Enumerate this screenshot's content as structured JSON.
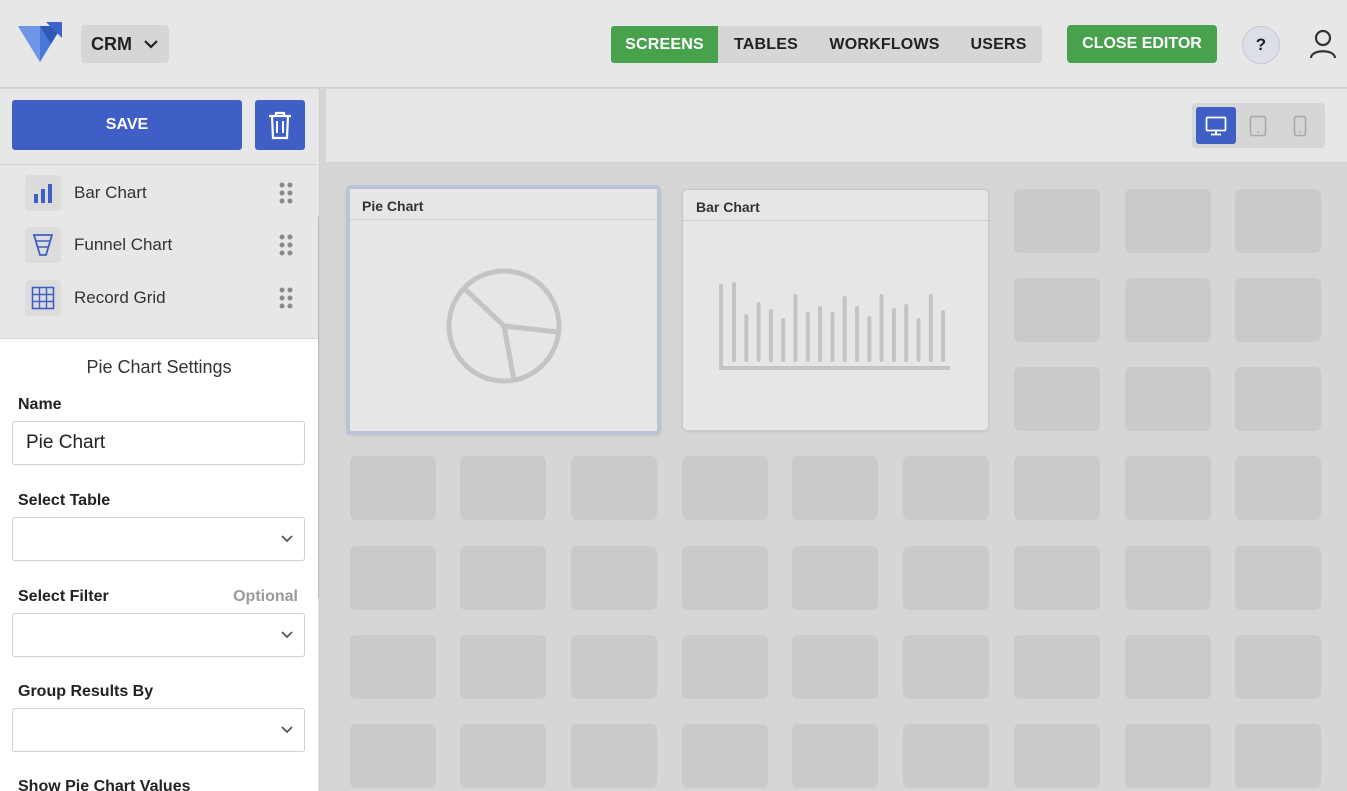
{
  "header": {
    "app_name": "CRM",
    "nav_tabs": [
      {
        "label": "SCREENS",
        "active": true
      },
      {
        "label": "TABLES",
        "active": false
      },
      {
        "label": "WORKFLOWS",
        "active": false
      },
      {
        "label": "USERS",
        "active": false
      }
    ],
    "close_editor_label": "CLOSE EDITOR",
    "help_label": "?"
  },
  "sidebar": {
    "save_label": "SAVE",
    "widgets": [
      {
        "label": "Bar Chart",
        "icon": "bar-chart-icon"
      },
      {
        "label": "Funnel Chart",
        "icon": "funnel-chart-icon"
      },
      {
        "label": "Record Grid",
        "icon": "grid-icon"
      }
    ],
    "settings": {
      "title": "Pie Chart Settings",
      "name_label": "Name",
      "name_value": "Pie Chart",
      "table_label": "Select Table",
      "table_value": "",
      "filter_label": "Select Filter",
      "filter_optional": "Optional",
      "filter_value": "",
      "group_label": "Group Results By",
      "group_value": "",
      "show_values_label": "Show Pie Chart Values"
    }
  },
  "canvas": {
    "devices": [
      {
        "name": "desktop",
        "active": true
      },
      {
        "name": "tablet",
        "active": false
      },
      {
        "name": "mobile",
        "active": false
      }
    ],
    "widgets": [
      {
        "title": "Pie Chart",
        "selected": true
      },
      {
        "title": "Bar Chart",
        "selected": false
      }
    ]
  },
  "colors": {
    "primary": "#3f5fc6",
    "success": "#48a14d",
    "background": "#d6d6d6"
  }
}
